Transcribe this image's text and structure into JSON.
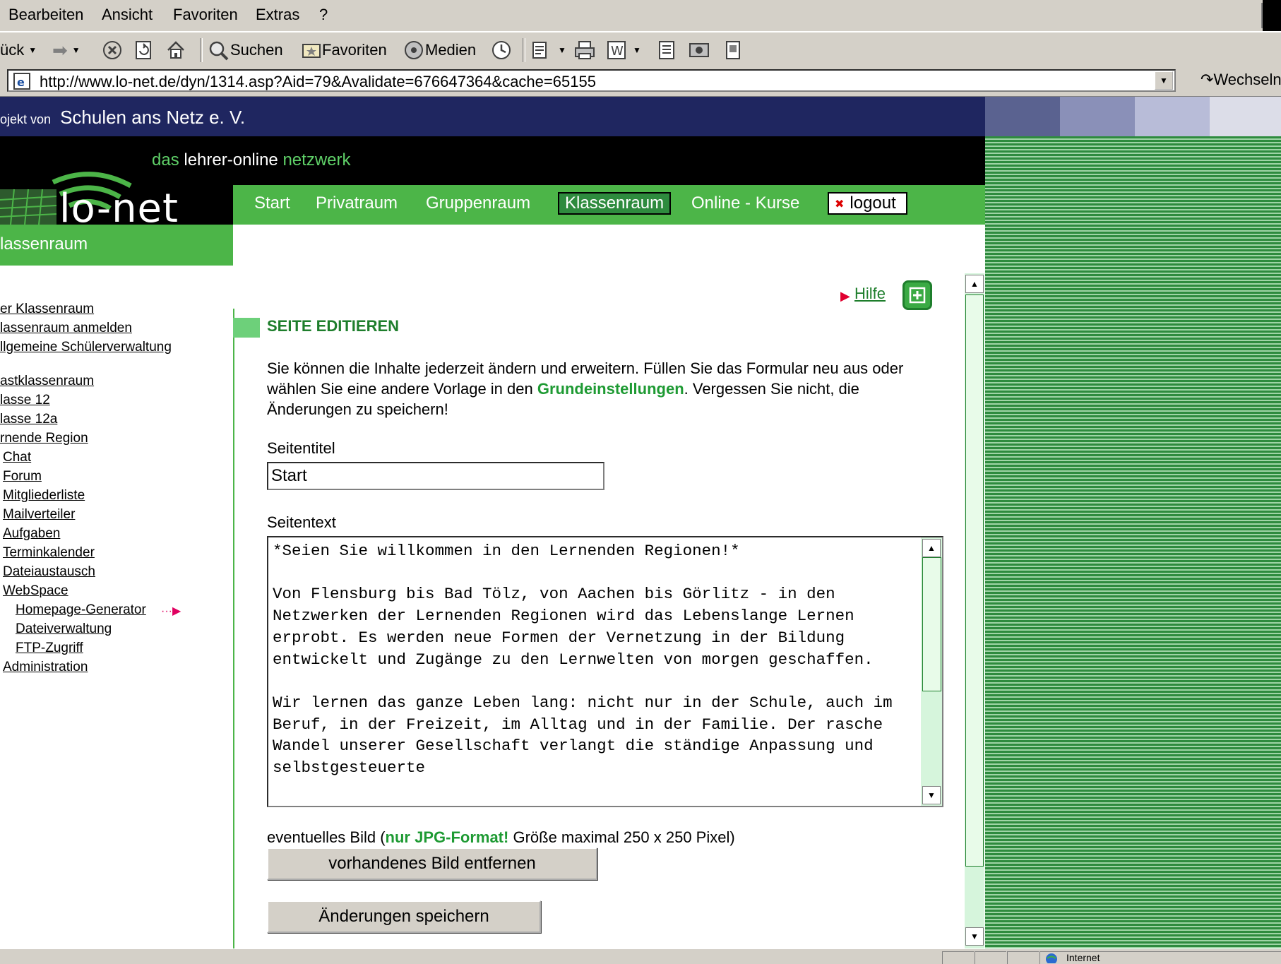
{
  "menu": {
    "items": [
      "Bearbeiten",
      "Ansicht",
      "Favoriten",
      "Extras",
      "?"
    ],
    "accels": [
      "B",
      "A",
      "F",
      "x",
      "?"
    ]
  },
  "toolbar": {
    "back_label": "ück",
    "search_label": "Suchen",
    "favorites_label": "Favoriten",
    "media_label": "Medien"
  },
  "address": {
    "url": "http://www.lo-net.de/dyn/1314.asp?Aid=79&Avalidate=676647364&cache=65155",
    "go_label": "Wechseln"
  },
  "header": {
    "project_prefix": "ojekt von",
    "project_name": "Schulen ans Netz e. V.",
    "tagline_das": "das",
    "tagline_main": "lehrer-online",
    "tagline_netzwerk": "netzwerk",
    "logo": "lo-net"
  },
  "nav": {
    "start": "Start",
    "privatraum": "Privatraum",
    "gruppenraum": "Gruppenraum",
    "klassenraum": "Klassenraum",
    "kurse": "Online - Kurse",
    "logout": "logout"
  },
  "section": {
    "label": "lassenraum"
  },
  "sidebar": {
    "items": [
      "er Klassenraum",
      "lassenraum anmelden",
      "llgemeine Schülerverwaltung",
      "astklassenraum",
      "lasse 12",
      "lasse 12a",
      "rnende  Region",
      "Chat",
      "Forum",
      "Mitgliederliste",
      "Mailverteiler",
      "Aufgaben",
      "Terminkalender",
      "Dateiaustausch",
      "WebSpace",
      "Homepage-Generator",
      "Dateiverwaltung",
      "FTP-Zugriff",
      "Administration"
    ],
    "active_marker": "···▶"
  },
  "content": {
    "help_label": "Hilfe",
    "title": "SEITE EDITIEREN",
    "intro_1": "Sie können die Inhalte jederzeit ändern und erweitern. Füllen Sie das Formular neu aus oder wählen Sie eine andere Vorlage in den ",
    "intro_link": "Grundeinstellungen",
    "intro_2": ". Vergessen Sie nicht, die Änderungen zu speichern!",
    "page_title_label": "Seitentitel",
    "page_title_value": "Start",
    "page_text_label": "Seitentext",
    "page_text_value": "*Seien Sie willkommen in den Lernenden Regionen!*\n\nVon Flensburg bis Bad Tölz, von Aachen bis Görlitz - in den Netzwerken der Lernenden Regionen wird das Lebenslange Lernen erprobt. Es werden neue Formen der Vernetzung in der Bildung entwickelt und Zugänge zu den Lernwelten von morgen geschaffen.\n\nWir lernen das ganze Leben lang: nicht nur in der Schule, auch im Beruf, in der Freizeit, im Alltag und in der Familie. Der rasche Wandel unserer Gesellschaft verlangt die ständige Anpassung und selbstgesteuerte",
    "image_label_1": "eventuelles Bild (",
    "image_label_green": "nur JPG-Format!",
    "image_label_2": " Größe maximal 250 x 250 Pixel)",
    "remove_image_button": "vorhandenes Bild entfernen",
    "save_button": "Änderungen speichern"
  },
  "status": {
    "zone": "Internet"
  },
  "colors": {
    "green": "#4cb548",
    "dark_green": "#1e7e2c",
    "navy": "#1f2660"
  }
}
